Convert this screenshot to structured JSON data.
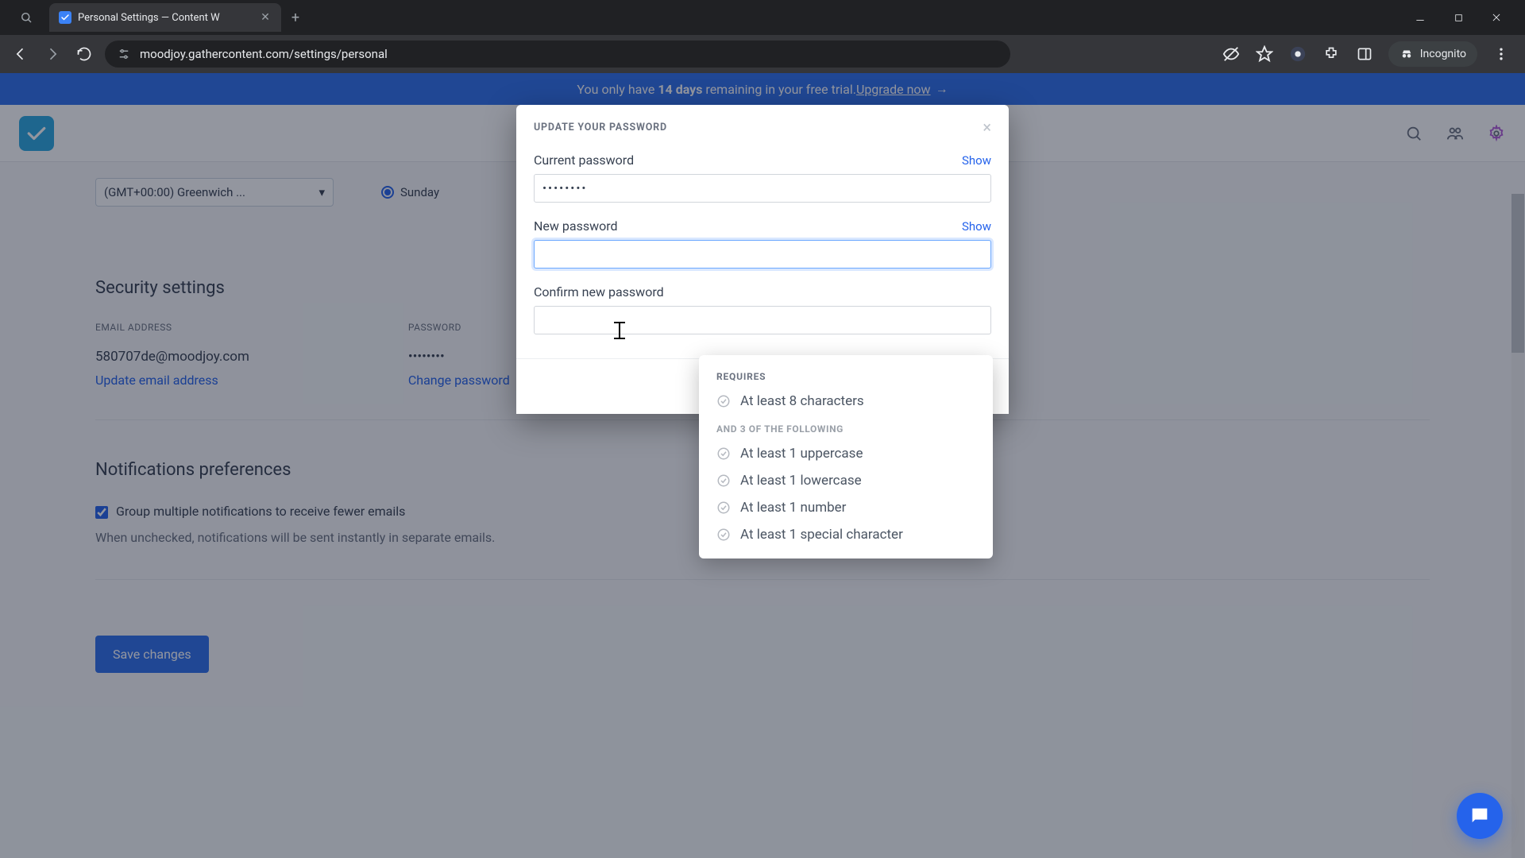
{
  "browser": {
    "tab_title": "Personal Settings — Content W",
    "url": "moodjoy.gathercontent.com/settings/personal",
    "incognito_label": "Incognito"
  },
  "banner": {
    "prefix": "You only have ",
    "days": "14 days",
    "suffix": " remaining in your free trial. ",
    "cta": "Upgrade now",
    "arrow": "→"
  },
  "page": {
    "timezone_value": "(GMT+00:00) Greenwich ...",
    "week_start_label": "Sunday",
    "security_heading": "Security settings",
    "email_label": "EMAIL ADDRESS",
    "email_value": "580707de@moodjoy.com",
    "email_link": "Update email address",
    "password_label": "PASSWORD",
    "password_value": "••••••••",
    "password_link": "Change password",
    "notifications_heading": "Notifications preferences",
    "notif_checkbox_label": "Group multiple notifications to receive fewer emails",
    "notif_desc": "When unchecked, notifications will be sent instantly in separate emails.",
    "save_button": "Save changes"
  },
  "modal": {
    "title": "UPDATE YOUR PASSWORD",
    "current_label": "Current password",
    "current_value": "••••••••",
    "current_show": "Show",
    "new_label": "New password",
    "new_show": "Show",
    "confirm_label": "Confirm new password"
  },
  "requirements": {
    "heading": "REQUIRES",
    "primary": "At least 8 characters",
    "sub_heading": "AND 3 OF THE FOLLOWING",
    "items": [
      "At least 1 uppercase",
      "At least 1 lowercase",
      "At least 1 number",
      "At least 1 special character"
    ]
  }
}
